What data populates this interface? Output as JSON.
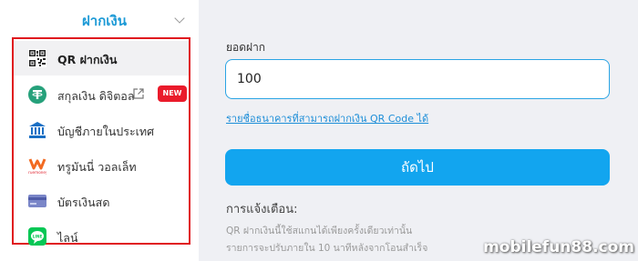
{
  "sidebar": {
    "title": "ฝากเงิน",
    "items": [
      {
        "label": "QR ฝากเงิน",
        "icon": "qr-code-icon"
      },
      {
        "label": "สกุลเงิน ดิจิตอล",
        "icon": "tether-icon",
        "badge": "NEW"
      },
      {
        "label": "บัญชีภายในประเทศ",
        "icon": "bank-icon"
      },
      {
        "label": "ทรูมันนี่ วอลเล็ท",
        "icon": "truemoney-icon",
        "icon_text": "truemoney"
      },
      {
        "label": "บัตรเงินสด",
        "icon": "card-icon"
      },
      {
        "label": "ไลน์",
        "icon": "line-icon",
        "icon_text": "LINE"
      }
    ]
  },
  "form": {
    "amount_label": "ยอดฝาก",
    "amount_value": "100",
    "bank_link": "รายชื่อธนาคารที่สามารถฝากเงิน QR Code ได้",
    "next_label": "ถัดไป"
  },
  "notice": {
    "title": "การแจ้งเตือน:",
    "lines": [
      "QR ฝากเงินนี้ใช้สแกนได้เพียงครั้งเดียวเท่านั้น",
      "รายการจะปรับภายใน 10 นาทีหลังจากโอนสำเร็จ"
    ]
  },
  "watermark": "mobilefun88.com",
  "colors": {
    "accent": "#12a5ef",
    "highlight_border": "#e0171e",
    "badge": "#ea1b2b",
    "link": "#1d8ed8"
  }
}
